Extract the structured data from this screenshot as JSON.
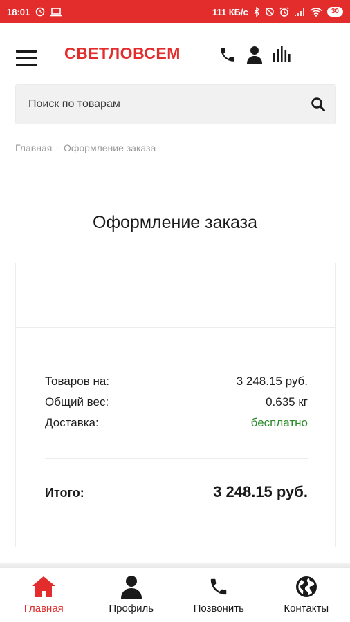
{
  "status_bar": {
    "time": "18:01",
    "network_speed": "111 КБ/с",
    "battery": "30"
  },
  "header": {
    "logo_text": "СВЕТЛОВСЕМ",
    "icons": [
      "menu-icon",
      "phone-icon",
      "user-icon",
      "bars-icon"
    ]
  },
  "search": {
    "placeholder": "Поиск по товарам"
  },
  "breadcrumb": {
    "home": "Главная",
    "separator": "-",
    "current": "Оформление заказа"
  },
  "page_title": "Оформление заказа",
  "summary": {
    "rows": [
      {
        "label": "Товаров на:",
        "value": "3 248.15 руб."
      },
      {
        "label": "Общий вес:",
        "value": "0.635 кг"
      },
      {
        "label": "Доставка:",
        "value": "бесплатно"
      }
    ],
    "total_label": "Итого:",
    "total_value": "3 248.15 руб."
  },
  "bottom_nav": {
    "items": [
      {
        "label": "Главная",
        "icon": "home-icon",
        "active": true
      },
      {
        "label": "Профиль",
        "icon": "profile-icon",
        "active": false
      },
      {
        "label": "Позвонить",
        "icon": "phone-icon",
        "active": false
      },
      {
        "label": "Контакты",
        "icon": "globe-icon",
        "active": false
      }
    ]
  },
  "colors": {
    "brand_red": "#e32c2c",
    "free_green": "#2d8a2d"
  }
}
